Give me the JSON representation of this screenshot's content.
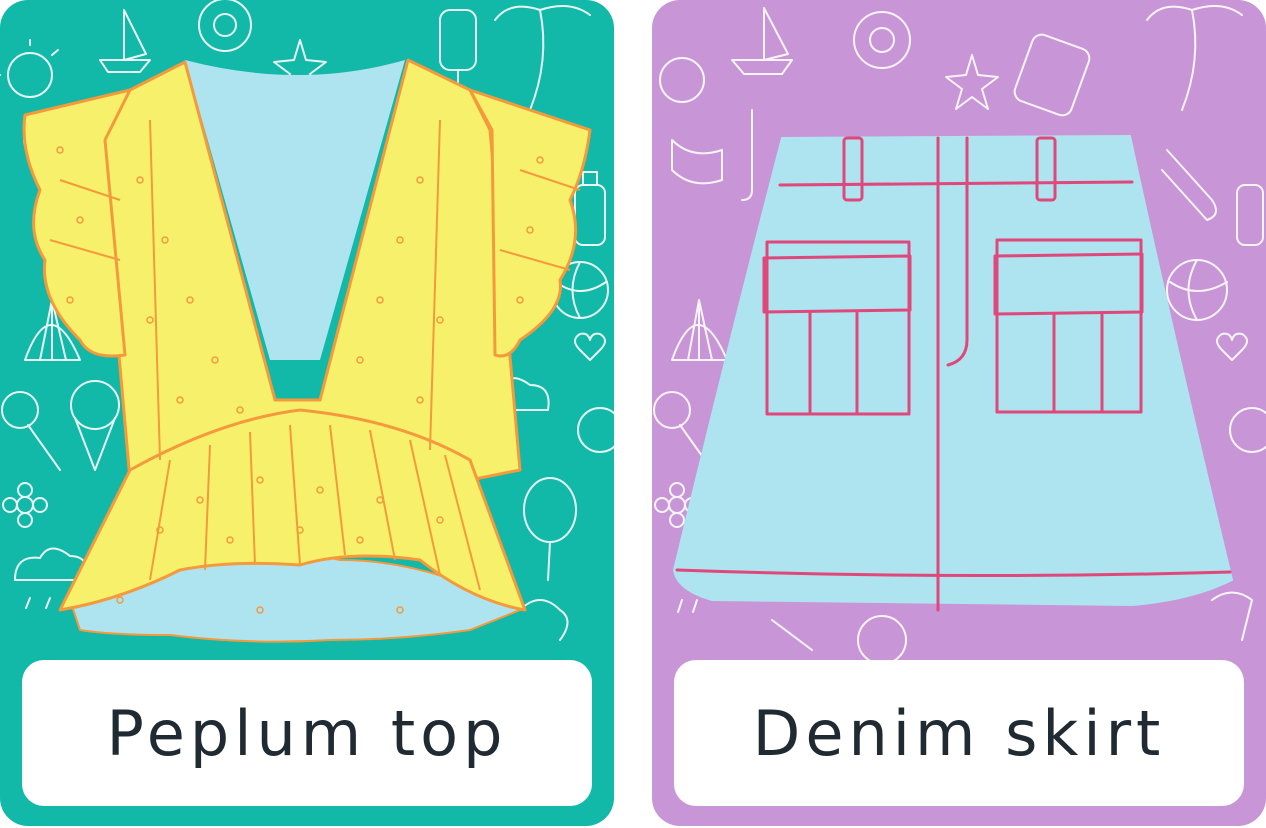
{
  "cards": [
    {
      "label": "Peplum top",
      "bg_color": "#12b8a8",
      "icon": "peplum-top-illustration"
    },
    {
      "label": "Denim skirt",
      "bg_color": "#c896d6",
      "icon": "denim-skirt-illustration"
    }
  ],
  "colors": {
    "doodle_line": "#ffffff",
    "top_fill": "#f6f06a",
    "top_line": "#f59a3c",
    "skirt_fill": "#aee3f0",
    "skirt_line": "#e0477a",
    "label_text": "#1f2a33"
  }
}
